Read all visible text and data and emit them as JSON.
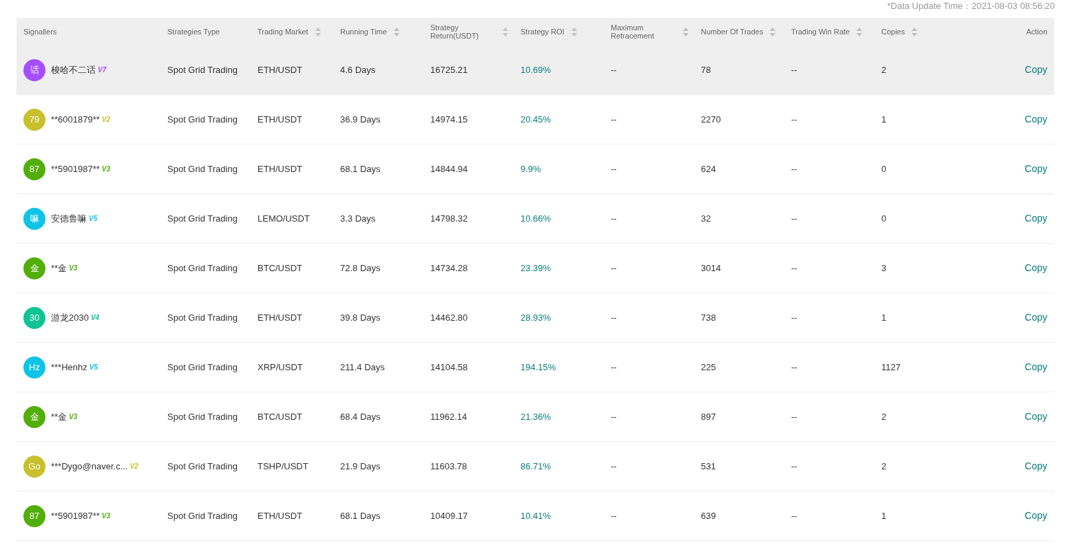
{
  "update_time": "*Data Update Time：2021-08-03 08:56:20",
  "columns": [
    {
      "label": "Signallers",
      "sortable": false
    },
    {
      "label": "Strategies Type",
      "sortable": false
    },
    {
      "label": "Trading Market",
      "sortable": true
    },
    {
      "label": "Running Time",
      "sortable": true
    },
    {
      "label": "Strategy Return(USDT)",
      "sortable": true
    },
    {
      "label": "Strategy ROI",
      "sortable": true
    },
    {
      "label": "Maximum Retracement",
      "sortable": true
    },
    {
      "label": "Number Of Trades",
      "sortable": true
    },
    {
      "label": "Trading Win Rate",
      "sortable": true
    },
    {
      "label": "Copies",
      "sortable": true
    },
    {
      "label": "Action",
      "sortable": false
    }
  ],
  "rows": [
    {
      "highlighted": true,
      "avatar": "话",
      "name": "梭哈不二话",
      "level": "V7",
      "color": "#a64dff",
      "type": "Spot Grid Trading",
      "market": "ETH/USDT",
      "running": "4.6 Days",
      "return": "16725.21",
      "roi": "10.69%",
      "retracement": "--",
      "trades": "78",
      "win_rate": "--",
      "copies": "2",
      "action": "Copy"
    },
    {
      "highlighted": false,
      "avatar": "79",
      "name": "**6001879**",
      "level": "V2",
      "color": "#c8c02c",
      "type": "Spot Grid Trading",
      "market": "ETH/USDT",
      "running": "36.9 Days",
      "return": "14974.15",
      "roi": "20.45%",
      "retracement": "--",
      "trades": "2270",
      "win_rate": "--",
      "copies": "1",
      "action": "Copy"
    },
    {
      "highlighted": false,
      "avatar": "87",
      "name": "**5901987**",
      "level": "V3",
      "color": "#52ae0b",
      "type": "Spot Grid Trading",
      "market": "ETH/USDT",
      "running": "68.1 Days",
      "return": "14844.94",
      "roi": "9.9%",
      "retracement": "--",
      "trades": "624",
      "win_rate": "--",
      "copies": "0",
      "action": "Copy"
    },
    {
      "highlighted": false,
      "avatar": "嘛",
      "name": "安德鲁嘛",
      "level": "V5",
      "color": "#0fc3e6",
      "type": "Spot Grid Trading",
      "market": "LEMO/USDT",
      "running": "3.3 Days",
      "return": "14798.32",
      "roi": "10.66%",
      "retracement": "--",
      "trades": "32",
      "win_rate": "--",
      "copies": "0",
      "action": "Copy"
    },
    {
      "highlighted": false,
      "avatar": "金",
      "name": "**金",
      "level": "V3",
      "color": "#52ae0b",
      "type": "Spot Grid Trading",
      "market": "BTC/USDT",
      "running": "72.8 Days",
      "return": "14734.28",
      "roi": "23.39%",
      "retracement": "--",
      "trades": "3014",
      "win_rate": "--",
      "copies": "3",
      "action": "Copy"
    },
    {
      "highlighted": false,
      "avatar": "30",
      "name": "游龙2030",
      "level": "V4",
      "color": "#10c394",
      "type": "Spot Grid Trading",
      "market": "ETH/USDT",
      "running": "39.8 Days",
      "return": "14462.80",
      "roi": "28.93%",
      "retracement": "--",
      "trades": "738",
      "win_rate": "--",
      "copies": "1",
      "action": "Copy"
    },
    {
      "highlighted": false,
      "avatar": "Hz",
      "name": "***Henhz",
      "level": "V5",
      "color": "#0fc3e6",
      "type": "Spot Grid Trading",
      "market": "XRP/USDT",
      "running": "211.4 Days",
      "return": "14104.58",
      "roi": "194.15%",
      "retracement": "--",
      "trades": "225",
      "win_rate": "--",
      "copies": "1127",
      "action": "Copy"
    },
    {
      "highlighted": false,
      "avatar": "金",
      "name": "**金",
      "level": "V3",
      "color": "#52ae0b",
      "type": "Spot Grid Trading",
      "market": "BTC/USDT",
      "running": "68.4 Days",
      "return": "11962.14",
      "roi": "21.36%",
      "retracement": "--",
      "trades": "897",
      "win_rate": "--",
      "copies": "2",
      "action": "Copy"
    },
    {
      "highlighted": false,
      "avatar": "Go",
      "name": "***Dygo@naver.c...",
      "level": "V2",
      "color": "#c8c02c",
      "type": "Spot Grid Trading",
      "market": "TSHP/USDT",
      "running": "21.9 Days",
      "return": "11603.78",
      "roi": "86.71%",
      "retracement": "--",
      "trades": "531",
      "win_rate": "--",
      "copies": "2",
      "action": "Copy"
    },
    {
      "highlighted": false,
      "avatar": "87",
      "name": "**5901987**",
      "level": "V3",
      "color": "#52ae0b",
      "type": "Spot Grid Trading",
      "market": "ETH/USDT",
      "running": "68.1 Days",
      "return": "10409.17",
      "roi": "10.41%",
      "retracement": "--",
      "trades": "639",
      "win_rate": "--",
      "copies": "1",
      "action": "Copy"
    }
  ]
}
